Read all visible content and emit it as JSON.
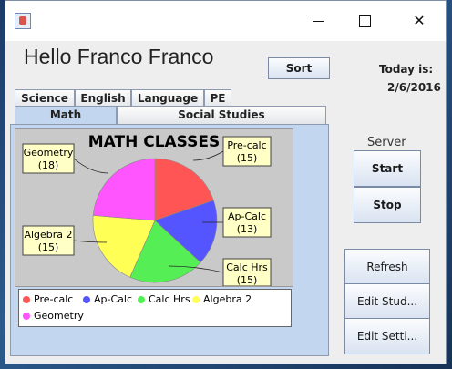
{
  "window": {
    "controls": {
      "close": "✕"
    }
  },
  "header": {
    "greeting": "Hello Franco Franco",
    "sort_label": "Sort",
    "today_label": "Today is:",
    "today_date": "2/6/2016"
  },
  "tabs": {
    "row1": [
      "Science",
      "English",
      "Language",
      "PE"
    ],
    "row2": [
      "Math",
      "Social Studies"
    ],
    "active": "Math"
  },
  "server": {
    "label": "Server",
    "start": "Start",
    "stop": "Stop"
  },
  "actions": {
    "refresh": "Refresh",
    "edit_students": "Edit Stud...",
    "edit_settings": "Edit Setti..."
  },
  "chart_data": {
    "type": "pie",
    "title": "MATH CLASSES",
    "slices": [
      {
        "label": "Pre-calc",
        "value": 15,
        "color": "#ff5555"
      },
      {
        "label": "Ap-Calc",
        "value": 13,
        "color": "#5555ff"
      },
      {
        "label": "Calc Hrs",
        "value": 15,
        "color": "#55ee55"
      },
      {
        "label": "Algebra 2",
        "value": 15,
        "color": "#ffff55"
      },
      {
        "label": "Geometry",
        "value": 18,
        "color": "#ff55ff"
      }
    ],
    "legend": "bottom"
  }
}
